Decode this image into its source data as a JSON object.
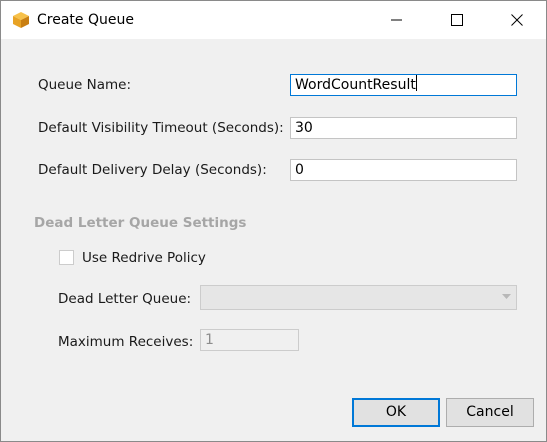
{
  "window": {
    "title": "Create Queue",
    "icon": "aws-cube-icon"
  },
  "form": {
    "queue_name_label": "Queue Name:",
    "queue_name_value": "WordCountResult",
    "visibility_timeout_label": "Default Visibility Timeout (Seconds):",
    "visibility_timeout_value": "30",
    "delivery_delay_label": "Default Delivery Delay (Seconds):",
    "delivery_delay_value": "0"
  },
  "dead_letter": {
    "section_title": "Dead Letter Queue Settings",
    "use_redrive_label": "Use Redrive Policy",
    "use_redrive_checked": false,
    "queue_label": "Dead Letter Queue:",
    "queue_value": "",
    "max_receives_label": "Maximum Receives:",
    "max_receives_value": "1"
  },
  "buttons": {
    "ok": "OK",
    "cancel": "Cancel"
  },
  "colors": {
    "focus_border": "#0078d7",
    "disabled_text": "#a6a6a6",
    "dialog_bg": "#f0f0f0"
  }
}
